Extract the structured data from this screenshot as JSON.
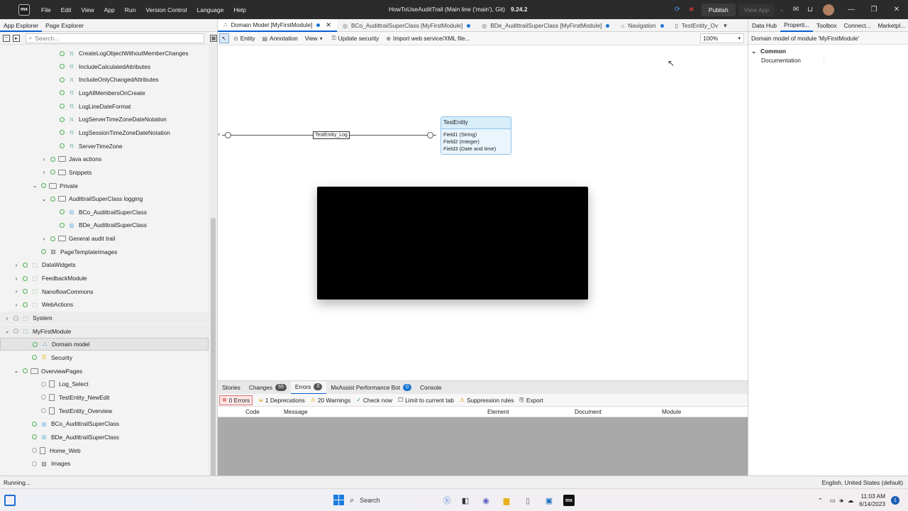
{
  "titlebar": {
    "logo": "mx",
    "menu": [
      "File",
      "Edit",
      "View",
      "App",
      "Run",
      "Version Control",
      "Language",
      "Help"
    ],
    "title": "HowToUseAuditTrail (Main line ('main'), Git)",
    "version": "9.24.2",
    "publish": "Publish",
    "view_app": "View App"
  },
  "left": {
    "tabs": [
      "App Explorer",
      "Page Explorer"
    ],
    "search_placeholder": "Search...",
    "tree": [
      {
        "label": "CreateLogObjectWithoutMemberChanges",
        "level": 6,
        "icon": "constant-icon"
      },
      {
        "label": "IncludeCalculatedAttributes",
        "level": 6,
        "icon": "constant-icon"
      },
      {
        "label": "IncludeOnlyChangedAttributes",
        "level": 6,
        "icon": "constant-icon"
      },
      {
        "label": "LogAllMembersOnCreate",
        "level": 6,
        "icon": "constant-icon"
      },
      {
        "label": "LogLineDateFormat",
        "level": 6,
        "icon": "constant-icon"
      },
      {
        "label": "LogServerTimeZoneDateNotation",
        "level": 6,
        "icon": "constant-icon"
      },
      {
        "label": "LogSessionTimeZoneDateNotation",
        "level": 6,
        "icon": "constant-icon"
      },
      {
        "label": "ServerTimeZone",
        "level": 6,
        "icon": "constant-icon"
      },
      {
        "label": "Java actions",
        "level": 5,
        "icon": "folder-icon",
        "chev": "›"
      },
      {
        "label": "Snippets",
        "level": 5,
        "icon": "folder-icon",
        "chev": "›"
      },
      {
        "label": "Private",
        "level": 4,
        "icon": "folder-icon",
        "chev": "⌄"
      },
      {
        "label": "AudittrailSuperClass logging",
        "level": 5,
        "icon": "folder-icon",
        "chev": "⌄"
      },
      {
        "label": "BCo_AudittrailSuperClass",
        "level": 6,
        "icon": "microflow-icon"
      },
      {
        "label": "BDe_AudittrailSuperClass",
        "level": 6,
        "icon": "microflow-icon"
      },
      {
        "label": "General audit trail",
        "level": 5,
        "icon": "folder-icon",
        "chev": "›"
      },
      {
        "label": "PageTemplateImages",
        "level": 4,
        "icon": "images-icon"
      },
      {
        "label": "DataWidgets",
        "level": 2,
        "icon": "module-icon",
        "chev": "›"
      },
      {
        "label": "FeedbackModule",
        "level": 2,
        "icon": "module-icon",
        "chev": "›"
      },
      {
        "label": "NanoflowCommons",
        "level": 2,
        "icon": "module-icon",
        "chev": "›"
      },
      {
        "label": "WebActions",
        "level": 2,
        "icon": "module-icon",
        "chev": "›"
      },
      {
        "label": "System",
        "level": 1,
        "icon": "module-icon",
        "chev": "›"
      },
      {
        "label": "MyFirstModule",
        "level": 1,
        "icon": "module-icon",
        "chev": "⌄"
      },
      {
        "label": "Domain model",
        "level": 3,
        "icon": "domain-model-icon",
        "selected": true
      },
      {
        "label": "Security",
        "level": 3,
        "icon": "key-icon"
      },
      {
        "label": "OverviewPages",
        "level": 2,
        "icon": "folder-icon",
        "chev": "⌄"
      },
      {
        "label": "Log_Select",
        "level": 4,
        "icon": "page-icon"
      },
      {
        "label": "TestEntity_NewEdit",
        "level": 4,
        "icon": "page-icon"
      },
      {
        "label": "TestEntity_Overview",
        "level": 4,
        "icon": "page-icon"
      },
      {
        "label": "BCo_AudittrailSuperClass",
        "level": 3,
        "icon": "microflow-icon"
      },
      {
        "label": "BDe_AudittrailSuperClass",
        "level": 3,
        "icon": "microflow-icon"
      },
      {
        "label": "Home_Web",
        "level": 3,
        "icon": "page-icon"
      },
      {
        "label": "Images",
        "level": 3,
        "icon": "images-icon"
      }
    ]
  },
  "doc_tabs": [
    {
      "label": "Domain Model [MyFirstModule]",
      "active": true
    },
    {
      "label": "BCo_AudittrailSuperClass [MyFirstModule]"
    },
    {
      "label": "BDe_AudittrailSuperClass [MyFirstModule]"
    },
    {
      "label": "Navigation"
    },
    {
      "label": "TestEntity_Ov"
    }
  ],
  "toolbar": {
    "entity": "Entity",
    "annotation": "Annotation",
    "view": "View",
    "update_security": "Update security",
    "import": "Import web service/XML file...",
    "zoom": "100%"
  },
  "canvas": {
    "association_label": "TestEntity_Log",
    "entity": {
      "name": "TestEntity",
      "attributes": [
        "Field1 (String)",
        "Field2 (Integer)",
        "Field3 (Date and time)"
      ]
    }
  },
  "right": {
    "tabs": [
      "Data Hub",
      "Properti...",
      "Toolbox",
      "Connect...",
      "Marketpl..."
    ],
    "title": "Domain model of module 'MyFirstModule'",
    "group": "Common",
    "row": "Documentation"
  },
  "bottom": {
    "tabs": [
      {
        "label": "Stories"
      },
      {
        "label": "Changes",
        "badge": "55"
      },
      {
        "label": "Errors",
        "badge": "0",
        "active": true
      },
      {
        "label": "MxAssist Performance Bot",
        "badge": "0",
        "blue": true
      },
      {
        "label": "Console"
      }
    ],
    "errors": "0 Errors",
    "deprecations": "1 Deprecations",
    "warnings": "20 Warnings",
    "check_now": "Check now",
    "limit": "Limit to current tab",
    "suppression": "Suppression rules",
    "export": "Export",
    "headers": [
      "Code",
      "Message",
      "Element",
      "Document",
      "Module"
    ]
  },
  "status": {
    "left": "Running...",
    "right": "English, United States (default)"
  },
  "taskbar": {
    "search": "Search",
    "time": "11:03 AM",
    "date": "6/14/2023",
    "notifications": "1"
  }
}
